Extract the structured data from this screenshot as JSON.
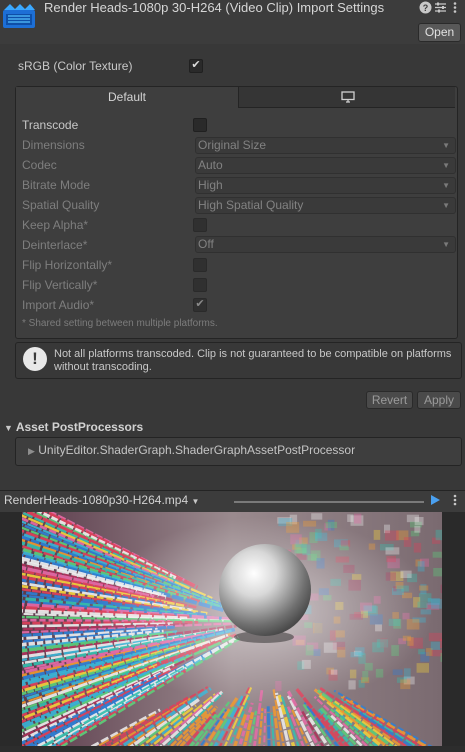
{
  "header": {
    "title": "Render Heads-1080p 30-H264 (Video Clip) Import Settings",
    "open_label": "Open",
    "icons": [
      "help-icon",
      "presets-icon",
      "more-icon"
    ]
  },
  "srgb": {
    "label": "sRGB (Color Texture)",
    "checked": true
  },
  "platform_tabs": {
    "default_label": "Default",
    "standalone_icon": "monitor-icon"
  },
  "settings": {
    "transcode": {
      "label": "Transcode",
      "checked": false
    },
    "dimensions": {
      "label": "Dimensions",
      "value": "Original Size"
    },
    "codec": {
      "label": "Codec",
      "value": "Auto"
    },
    "bitrate_mode": {
      "label": "Bitrate Mode",
      "value": "High"
    },
    "spatial_quality": {
      "label": "Spatial Quality",
      "value": "High Spatial Quality"
    },
    "keep_alpha": {
      "label": "Keep Alpha*",
      "checked": false
    },
    "deinterlace": {
      "label": "Deinterlace*",
      "value": "Off"
    },
    "flip_horizontally": {
      "label": "Flip Horizontally*",
      "checked": false
    },
    "flip_vertically": {
      "label": "Flip Vertically*",
      "checked": false
    },
    "import_audio": {
      "label": "Import Audio*",
      "checked": true
    },
    "shared_note": "* Shared setting between multiple platforms."
  },
  "warning": {
    "icon": "warning-icon",
    "text": "Not all platforms transcoded. Clip is not guaranteed to be compatible on platforms without transcoding."
  },
  "actions": {
    "revert_label": "Revert",
    "apply_label": "Apply"
  },
  "postprocessors": {
    "header": "Asset PostProcessors",
    "items": [
      "UnityEditor.ShaderGraph.ShaderGraphAssetPostProcessor"
    ]
  },
  "preview": {
    "clip_name": "RenderHeads-1080p30-H264.mp4",
    "progress": 0
  },
  "colors": {
    "accent": "#4aa0f0",
    "background": "#383838"
  }
}
